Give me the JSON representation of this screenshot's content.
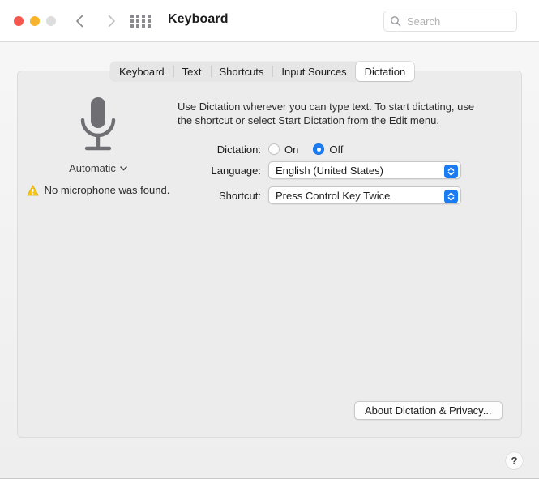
{
  "window": {
    "title": "Keyboard",
    "traffic_lights": [
      {
        "name": "close",
        "color": "#f5564d"
      },
      {
        "name": "minimize",
        "color": "#f7b32b"
      },
      {
        "name": "zoom",
        "color": "#dddddd"
      }
    ],
    "nav": {
      "back_icon": "chevron-left-icon",
      "forward_icon": "chevron-right-icon"
    },
    "show_all_icon": "grid-icon"
  },
  "search": {
    "placeholder": "Search",
    "value": "",
    "icon": "search-icon"
  },
  "tabs": [
    {
      "label": "Keyboard",
      "selected": false
    },
    {
      "label": "Text",
      "selected": false
    },
    {
      "label": "Shortcuts",
      "selected": false
    },
    {
      "label": "Input Sources",
      "selected": false
    },
    {
      "label": "Dictation",
      "selected": true
    }
  ],
  "mic_panel": {
    "icon": "microphone-icon",
    "source_label": "Automatic",
    "source_chevron_icon": "chevron-down-icon",
    "warning_icon": "warning-triangle-icon",
    "warning_text": "No microphone was found.",
    "warning_color": "#f5c518"
  },
  "description": "Use Dictation wherever you can type text. To start dictating, use the shortcut or select Start Dictation from the Edit menu.",
  "form": {
    "dictation": {
      "label": "Dictation:",
      "options": [
        {
          "label": "On",
          "selected": false
        },
        {
          "label": "Off",
          "selected": true
        }
      ],
      "selected": "Off"
    },
    "language": {
      "label": "Language:",
      "value": "English (United States)",
      "stepper_icon": "stepper-updown-icon"
    },
    "shortcut": {
      "label": "Shortcut:",
      "value": "Press Control Key Twice",
      "stepper_icon": "stepper-updown-icon"
    }
  },
  "footer": {
    "about_button": "About Dictation & Privacy...",
    "help_button": "?"
  },
  "colors": {
    "accent": "#1a7bf2",
    "panel_bg": "#ececec",
    "titlebar_bg": "#ffffff"
  }
}
